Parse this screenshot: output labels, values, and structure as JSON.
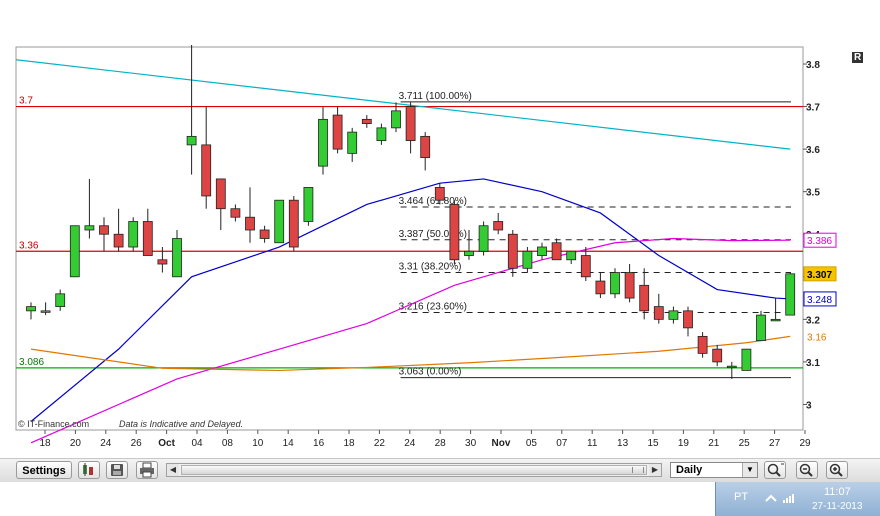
{
  "chart_data": {
    "type": "candlestick",
    "ylim": [
      2.94,
      3.84
    ],
    "y_ticks": [
      "3.8",
      "3.7",
      "3.6",
      "3.5",
      "3.4",
      "3.3",
      "3.2",
      "3.1",
      "3"
    ],
    "x_ticks": [
      "18",
      "20",
      "24",
      "26",
      "Oct",
      "04",
      "08",
      "10",
      "14",
      "16",
      "18",
      "22",
      "24",
      "28",
      "30",
      "Nov",
      "05",
      "07",
      "11",
      "13",
      "15",
      "19",
      "21",
      "25",
      "27",
      "29"
    ],
    "candles": [
      {
        "o": 3.22,
        "h": 3.24,
        "l": 3.2,
        "c": 3.23
      },
      {
        "o": 3.22,
        "h": 3.24,
        "l": 3.21,
        "c": 3.22
      },
      {
        "o": 3.23,
        "h": 3.27,
        "l": 3.22,
        "c": 3.26
      },
      {
        "o": 3.3,
        "h": 3.42,
        "l": 3.3,
        "c": 3.42
      },
      {
        "o": 3.41,
        "h": 3.53,
        "l": 3.39,
        "c": 3.42
      },
      {
        "o": 3.42,
        "h": 3.44,
        "l": 3.36,
        "c": 3.4
      },
      {
        "o": 3.4,
        "h": 3.46,
        "l": 3.36,
        "c": 3.37
      },
      {
        "o": 3.37,
        "h": 3.44,
        "l": 3.36,
        "c": 3.43
      },
      {
        "o": 3.43,
        "h": 3.46,
        "l": 3.35,
        "c": 3.35
      },
      {
        "o": 3.34,
        "h": 3.37,
        "l": 3.31,
        "c": 3.33
      },
      {
        "o": 3.3,
        "h": 3.41,
        "l": 3.3,
        "c": 3.39
      },
      {
        "o": 3.61,
        "h": 3.85,
        "l": 3.54,
        "c": 3.63
      },
      {
        "o": 3.61,
        "h": 3.7,
        "l": 3.46,
        "c": 3.49
      },
      {
        "o": 3.53,
        "h": 3.53,
        "l": 3.41,
        "c": 3.46
      },
      {
        "o": 3.46,
        "h": 3.47,
        "l": 3.43,
        "c": 3.44
      },
      {
        "o": 3.44,
        "h": 3.51,
        "l": 3.38,
        "c": 3.41
      },
      {
        "o": 3.41,
        "h": 3.42,
        "l": 3.38,
        "c": 3.39
      },
      {
        "o": 3.38,
        "h": 3.48,
        "l": 3.38,
        "c": 3.48
      },
      {
        "o": 3.48,
        "h": 3.49,
        "l": 3.36,
        "c": 3.37
      },
      {
        "o": 3.43,
        "h": 3.51,
        "l": 3.42,
        "c": 3.51
      },
      {
        "o": 3.56,
        "h": 3.7,
        "l": 3.54,
        "c": 3.67
      },
      {
        "o": 3.68,
        "h": 3.7,
        "l": 3.59,
        "c": 3.6
      },
      {
        "o": 3.59,
        "h": 3.65,
        "l": 3.57,
        "c": 3.64
      },
      {
        "o": 3.67,
        "h": 3.68,
        "l": 3.65,
        "c": 3.66
      },
      {
        "o": 3.62,
        "h": 3.66,
        "l": 3.61,
        "c": 3.65
      },
      {
        "o": 3.65,
        "h": 3.71,
        "l": 3.64,
        "c": 3.69
      },
      {
        "o": 3.7,
        "h": 3.71,
        "l": 3.59,
        "c": 3.62
      },
      {
        "o": 3.63,
        "h": 3.64,
        "l": 3.55,
        "c": 3.58
      },
      {
        "o": 3.51,
        "h": 3.52,
        "l": 3.47,
        "c": 3.48
      },
      {
        "o": 3.47,
        "h": 3.48,
        "l": 3.33,
        "c": 3.34
      },
      {
        "o": 3.35,
        "h": 3.41,
        "l": 3.34,
        "c": 3.36
      },
      {
        "o": 3.36,
        "h": 3.43,
        "l": 3.35,
        "c": 3.42
      },
      {
        "o": 3.43,
        "h": 3.45,
        "l": 3.4,
        "c": 3.41
      },
      {
        "o": 3.4,
        "h": 3.41,
        "l": 3.3,
        "c": 3.32
      },
      {
        "o": 3.32,
        "h": 3.37,
        "l": 3.31,
        "c": 3.36
      },
      {
        "o": 3.35,
        "h": 3.38,
        "l": 3.34,
        "c": 3.37
      },
      {
        "o": 3.38,
        "h": 3.39,
        "l": 3.34,
        "c": 3.34
      },
      {
        "o": 3.34,
        "h": 3.36,
        "l": 3.33,
        "c": 3.36
      },
      {
        "o": 3.35,
        "h": 3.37,
        "l": 3.29,
        "c": 3.3
      },
      {
        "o": 3.29,
        "h": 3.31,
        "l": 3.25,
        "c": 3.26
      },
      {
        "o": 3.26,
        "h": 3.32,
        "l": 3.25,
        "c": 3.31
      },
      {
        "o": 3.31,
        "h": 3.33,
        "l": 3.24,
        "c": 3.25
      },
      {
        "o": 3.28,
        "h": 3.32,
        "l": 3.2,
        "c": 3.22
      },
      {
        "o": 3.23,
        "h": 3.26,
        "l": 3.19,
        "c": 3.2
      },
      {
        "o": 3.2,
        "h": 3.23,
        "l": 3.19,
        "c": 3.22
      },
      {
        "o": 3.22,
        "h": 3.23,
        "l": 3.16,
        "c": 3.18
      },
      {
        "o": 3.16,
        "h": 3.17,
        "l": 3.11,
        "c": 3.12
      },
      {
        "o": 3.13,
        "h": 3.14,
        "l": 3.09,
        "c": 3.1
      },
      {
        "o": 3.09,
        "h": 3.1,
        "l": 3.06,
        "c": 3.09
      },
      {
        "o": 3.08,
        "h": 3.13,
        "l": 3.08,
        "c": 3.13
      },
      {
        "o": 3.15,
        "h": 3.22,
        "l": 3.15,
        "c": 3.21
      },
      {
        "o": 3.2,
        "h": 3.25,
        "l": 3.2,
        "c": 3.2
      },
      {
        "o": 3.21,
        "h": 3.31,
        "l": 3.21,
        "c": 3.307
      }
    ],
    "moving_averages": [
      {
        "color": "#0000cc",
        "values": [
          [
            0,
            2.96
          ],
          [
            6,
            3.13
          ],
          [
            11,
            3.3
          ],
          [
            17,
            3.37
          ],
          [
            23,
            3.47
          ],
          [
            28,
            3.52
          ],
          [
            31,
            3.53
          ],
          [
            35,
            3.5
          ],
          [
            39,
            3.45
          ],
          [
            43,
            3.35
          ],
          [
            47,
            3.27
          ],
          [
            51,
            3.25
          ],
          [
            52,
            3.248
          ]
        ]
      },
      {
        "color": "#e000e0",
        "values": [
          [
            0,
            2.91
          ],
          [
            10,
            3.06
          ],
          [
            17,
            3.13
          ],
          [
            23,
            3.19
          ],
          [
            29,
            3.28
          ],
          [
            35,
            3.34
          ],
          [
            40,
            3.38
          ],
          [
            44,
            3.39
          ],
          [
            48,
            3.385
          ],
          [
            52,
            3.386
          ]
        ]
      },
      {
        "color": "#e07800",
        "values": [
          [
            0,
            3.13
          ],
          [
            9,
            3.085
          ],
          [
            17,
            3.08
          ],
          [
            23,
            3.087
          ],
          [
            30,
            3.098
          ],
          [
            36,
            3.11
          ],
          [
            43,
            3.125
          ],
          [
            49,
            3.145
          ],
          [
            52,
            3.16
          ]
        ]
      }
    ],
    "trendline": {
      "color": "#00b4c8",
      "from": [
        0,
        3.81
      ],
      "to": [
        52,
        3.6
      ]
    },
    "horizontal_lines": [
      {
        "value": 3.7,
        "label": "3.7",
        "color": "#e00000"
      },
      {
        "value": 3.36,
        "label": "3.36",
        "color": "#e00000"
      },
      {
        "value": 3.086,
        "label": "3.086",
        "color": "#00b000"
      }
    ],
    "fibonacci": {
      "start_index": 26,
      "end_index": 52,
      "levels": [
        {
          "value": 3.711,
          "label": "3.711 (100.00%)"
        },
        {
          "value": 3.464,
          "label": "3.464 (61.80%)"
        },
        {
          "value": 3.387,
          "label": "3.387 (50.00%)"
        },
        {
          "value": 3.31,
          "label": "3.31 (38.20%)"
        },
        {
          "value": 3.216,
          "label": "3.216 (23.60%)"
        },
        {
          "value": 3.063,
          "label": "3.063 (0.00%)"
        }
      ]
    },
    "right_badges": [
      {
        "value": 3.386,
        "label": "3.386",
        "color": "#e000e0"
      },
      {
        "value": 3.307,
        "label": "3.307",
        "color": "#d8a000"
      },
      {
        "value": 3.248,
        "label": "3.248",
        "color": "#0000cc"
      },
      {
        "value": 3.16,
        "label": "3.16",
        "color": "#e07800"
      }
    ],
    "colors": {
      "up": "#33cc33",
      "down": "#dd4444",
      "candle_outline": "#222222"
    },
    "footer_brand": "© IT-Finance.com",
    "footer_note": "Data is Indicative and Delayed."
  },
  "toolbar": {
    "settings_label": "Settings",
    "period_value": "Daily"
  },
  "taskbar": {
    "language": "PT",
    "time": "11:07",
    "date": "27-11-2013"
  },
  "top_right_label": "R"
}
